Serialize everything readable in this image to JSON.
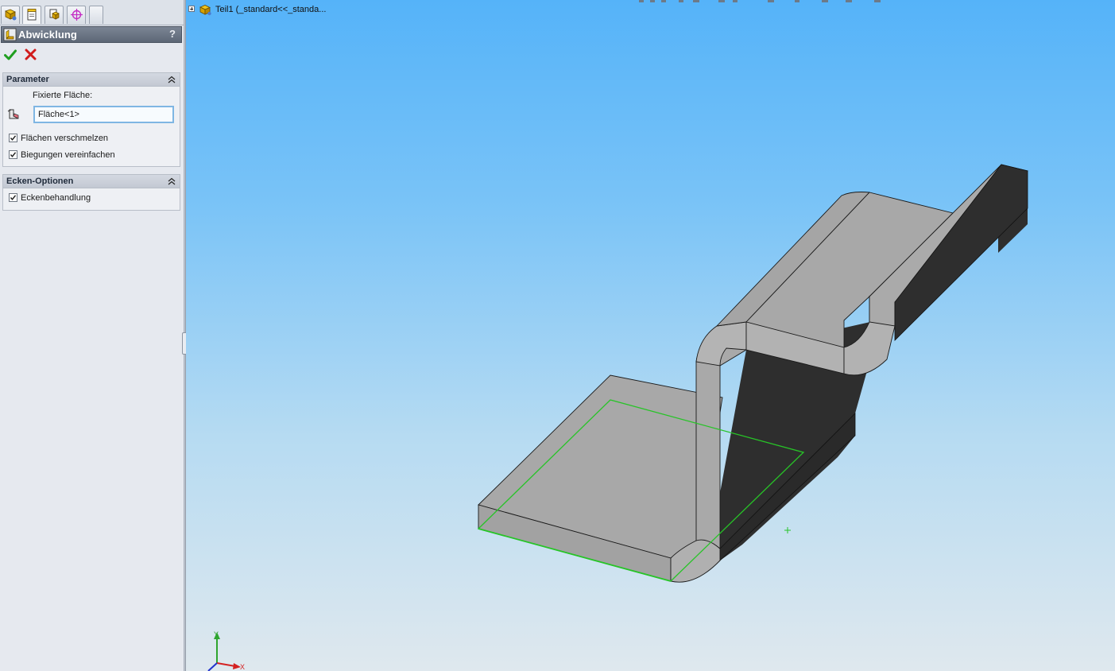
{
  "property_manager": {
    "tabs": [
      {
        "name": "feature-manager-tab",
        "icon": "feature-tree-icon"
      },
      {
        "name": "property-manager-tab",
        "icon": "property-sheet-icon"
      },
      {
        "name": "configuration-manager-tab",
        "icon": "configuration-icon"
      },
      {
        "name": "dimxpert-manager-tab",
        "icon": "target-crosshair-icon"
      }
    ],
    "title": "Abwicklung",
    "help_label": "?",
    "ok_icon": "checkmark-icon",
    "cancel_icon": "x-icon",
    "parameter_group": {
      "title": "Parameter",
      "fixed_face_label": "Fixierte Fläche:",
      "fixed_face_value": "Fläche<1>",
      "merge_faces_label": "Flächen verschmelzen",
      "merge_faces_checked": true,
      "simplify_bends_label": "Biegungen vereinfachen",
      "simplify_bends_checked": true
    },
    "corner_group": {
      "title": "Ecken-Optionen",
      "corner_treatment_label": "Eckenbehandlung",
      "corner_treatment_checked": true
    }
  },
  "viewport": {
    "tree_root_label": "Teil1  (_standard<<_standa...",
    "triad": {
      "x_label": "X",
      "y_label": "Y"
    },
    "colors": {
      "sky_top": "#55b3f9",
      "sky_bottom": "#dfe8ee",
      "part_face_light": "#a9a9a9",
      "part_face_dark": "#2e2e2e",
      "selection_highlight": "#27c427"
    }
  }
}
